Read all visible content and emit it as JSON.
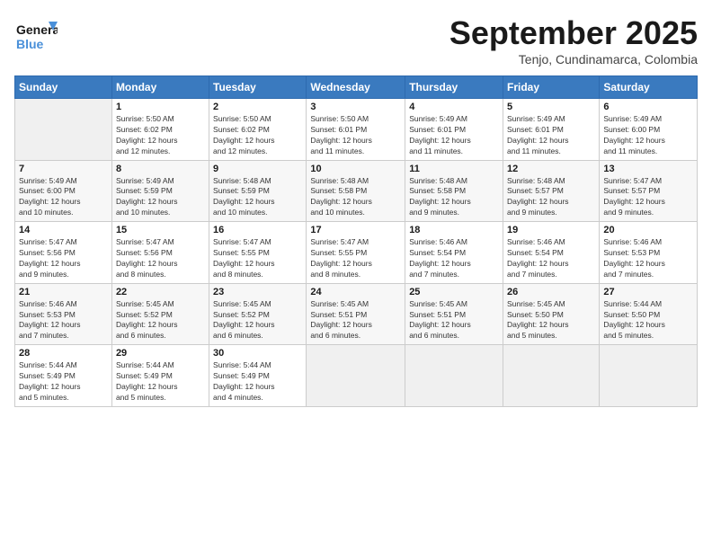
{
  "logo": {
    "line1": "General",
    "line2": "Blue"
  },
  "title": "September 2025",
  "subtitle": "Tenjo, Cundinamarca, Colombia",
  "days_header": [
    "Sunday",
    "Monday",
    "Tuesday",
    "Wednesday",
    "Thursday",
    "Friday",
    "Saturday"
  ],
  "weeks": [
    [
      {
        "day": "",
        "info": ""
      },
      {
        "day": "1",
        "info": "Sunrise: 5:50 AM\nSunset: 6:02 PM\nDaylight: 12 hours\nand 12 minutes."
      },
      {
        "day": "2",
        "info": "Sunrise: 5:50 AM\nSunset: 6:02 PM\nDaylight: 12 hours\nand 12 minutes."
      },
      {
        "day": "3",
        "info": "Sunrise: 5:50 AM\nSunset: 6:01 PM\nDaylight: 12 hours\nand 11 minutes."
      },
      {
        "day": "4",
        "info": "Sunrise: 5:49 AM\nSunset: 6:01 PM\nDaylight: 12 hours\nand 11 minutes."
      },
      {
        "day": "5",
        "info": "Sunrise: 5:49 AM\nSunset: 6:01 PM\nDaylight: 12 hours\nand 11 minutes."
      },
      {
        "day": "6",
        "info": "Sunrise: 5:49 AM\nSunset: 6:00 PM\nDaylight: 12 hours\nand 11 minutes."
      }
    ],
    [
      {
        "day": "7",
        "info": "Sunrise: 5:49 AM\nSunset: 6:00 PM\nDaylight: 12 hours\nand 10 minutes."
      },
      {
        "day": "8",
        "info": "Sunrise: 5:49 AM\nSunset: 5:59 PM\nDaylight: 12 hours\nand 10 minutes."
      },
      {
        "day": "9",
        "info": "Sunrise: 5:48 AM\nSunset: 5:59 PM\nDaylight: 12 hours\nand 10 minutes."
      },
      {
        "day": "10",
        "info": "Sunrise: 5:48 AM\nSunset: 5:58 PM\nDaylight: 12 hours\nand 10 minutes."
      },
      {
        "day": "11",
        "info": "Sunrise: 5:48 AM\nSunset: 5:58 PM\nDaylight: 12 hours\nand 9 minutes."
      },
      {
        "day": "12",
        "info": "Sunrise: 5:48 AM\nSunset: 5:57 PM\nDaylight: 12 hours\nand 9 minutes."
      },
      {
        "day": "13",
        "info": "Sunrise: 5:47 AM\nSunset: 5:57 PM\nDaylight: 12 hours\nand 9 minutes."
      }
    ],
    [
      {
        "day": "14",
        "info": "Sunrise: 5:47 AM\nSunset: 5:56 PM\nDaylight: 12 hours\nand 9 minutes."
      },
      {
        "day": "15",
        "info": "Sunrise: 5:47 AM\nSunset: 5:56 PM\nDaylight: 12 hours\nand 8 minutes."
      },
      {
        "day": "16",
        "info": "Sunrise: 5:47 AM\nSunset: 5:55 PM\nDaylight: 12 hours\nand 8 minutes."
      },
      {
        "day": "17",
        "info": "Sunrise: 5:47 AM\nSunset: 5:55 PM\nDaylight: 12 hours\nand 8 minutes."
      },
      {
        "day": "18",
        "info": "Sunrise: 5:46 AM\nSunset: 5:54 PM\nDaylight: 12 hours\nand 7 minutes."
      },
      {
        "day": "19",
        "info": "Sunrise: 5:46 AM\nSunset: 5:54 PM\nDaylight: 12 hours\nand 7 minutes."
      },
      {
        "day": "20",
        "info": "Sunrise: 5:46 AM\nSunset: 5:53 PM\nDaylight: 12 hours\nand 7 minutes."
      }
    ],
    [
      {
        "day": "21",
        "info": "Sunrise: 5:46 AM\nSunset: 5:53 PM\nDaylight: 12 hours\nand 7 minutes."
      },
      {
        "day": "22",
        "info": "Sunrise: 5:45 AM\nSunset: 5:52 PM\nDaylight: 12 hours\nand 6 minutes."
      },
      {
        "day": "23",
        "info": "Sunrise: 5:45 AM\nSunset: 5:52 PM\nDaylight: 12 hours\nand 6 minutes."
      },
      {
        "day": "24",
        "info": "Sunrise: 5:45 AM\nSunset: 5:51 PM\nDaylight: 12 hours\nand 6 minutes."
      },
      {
        "day": "25",
        "info": "Sunrise: 5:45 AM\nSunset: 5:51 PM\nDaylight: 12 hours\nand 6 minutes."
      },
      {
        "day": "26",
        "info": "Sunrise: 5:45 AM\nSunset: 5:50 PM\nDaylight: 12 hours\nand 5 minutes."
      },
      {
        "day": "27",
        "info": "Sunrise: 5:44 AM\nSunset: 5:50 PM\nDaylight: 12 hours\nand 5 minutes."
      }
    ],
    [
      {
        "day": "28",
        "info": "Sunrise: 5:44 AM\nSunset: 5:49 PM\nDaylight: 12 hours\nand 5 minutes."
      },
      {
        "day": "29",
        "info": "Sunrise: 5:44 AM\nSunset: 5:49 PM\nDaylight: 12 hours\nand 5 minutes."
      },
      {
        "day": "30",
        "info": "Sunrise: 5:44 AM\nSunset: 5:49 PM\nDaylight: 12 hours\nand 4 minutes."
      },
      {
        "day": "",
        "info": ""
      },
      {
        "day": "",
        "info": ""
      },
      {
        "day": "",
        "info": ""
      },
      {
        "day": "",
        "info": ""
      }
    ]
  ]
}
